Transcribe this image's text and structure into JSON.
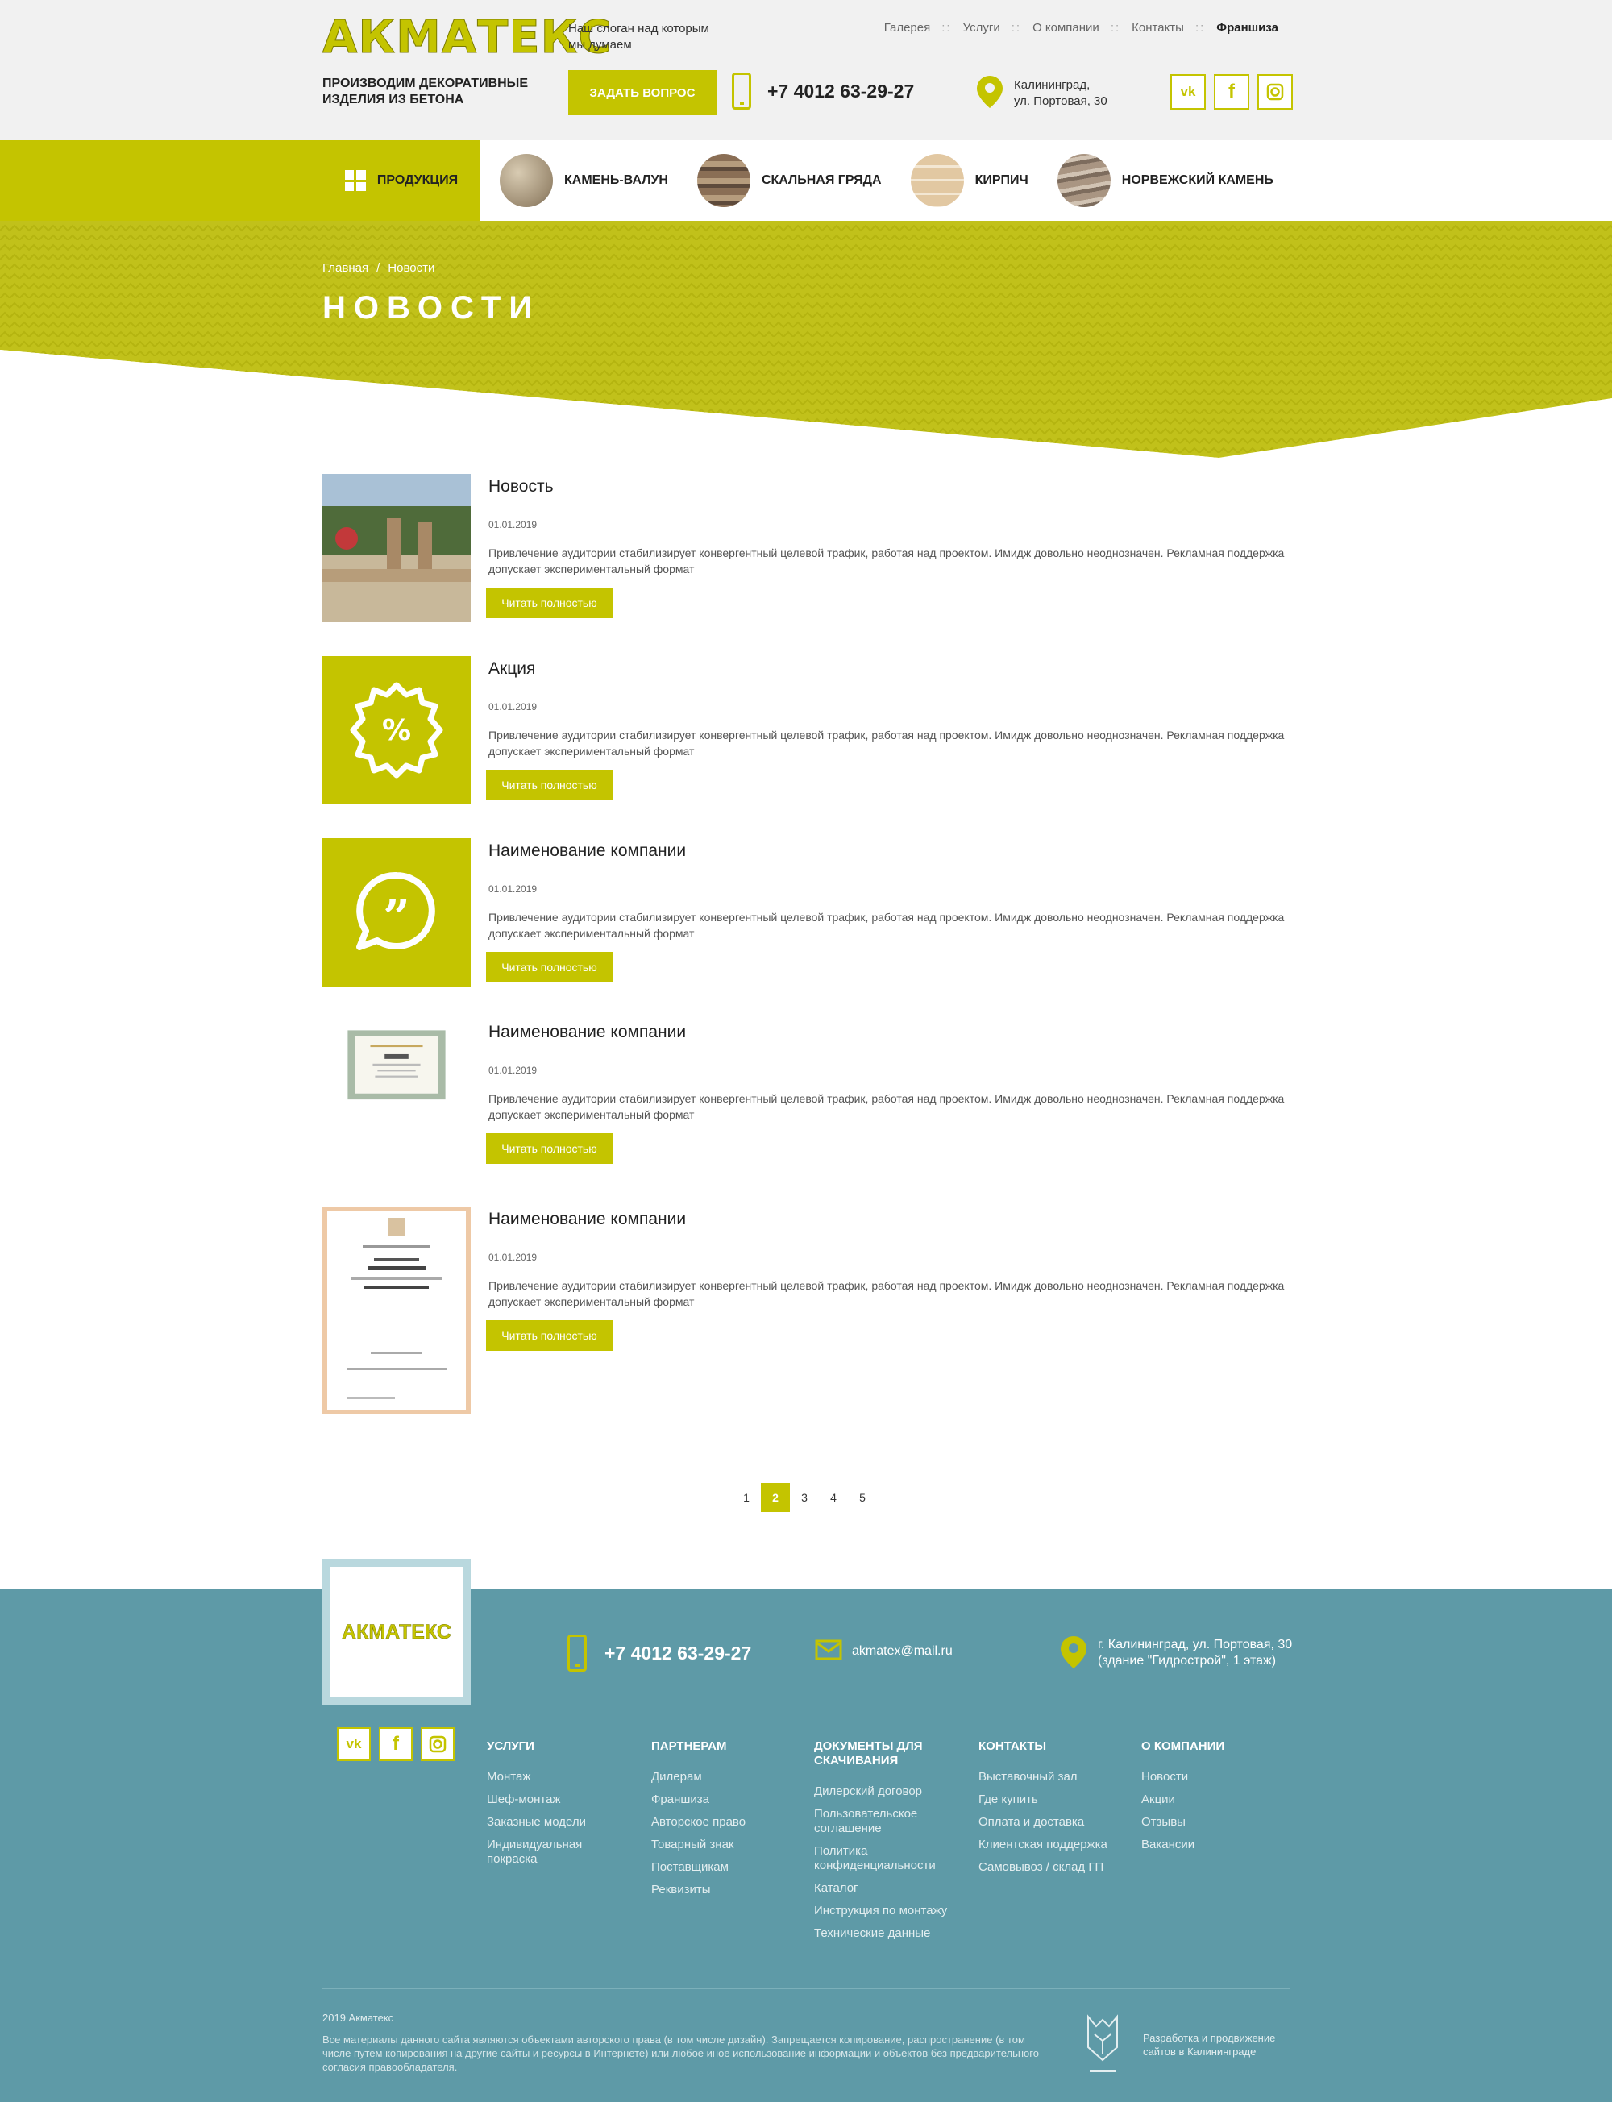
{
  "header": {
    "logo_main": "АКМАТЕКС",
    "slogan": "Наш слоган над которым мы думаем",
    "tagline": "ПРОИЗВОДИМ ДЕКОРАТИВНЫЕ ИЗДЕЛИЯ ИЗ БЕТОНА",
    "ask_button": "ЗАДАТЬ ВОПРОС",
    "phone": "+7 4012 63-29-27",
    "address_line1": "Калининград,",
    "address_line2": "ул. Портовая, 30",
    "topnav": [
      "Галерея",
      "Услуги",
      "О компании",
      "Контакты",
      "Франшиза"
    ],
    "social": [
      "vk",
      "f",
      "ig"
    ]
  },
  "prodnav": {
    "menu_label": "ПРОДУКЦИЯ",
    "categories": [
      "КАМЕНЬ-ВАЛУН",
      "СКАЛЬНАЯ ГРЯДА",
      "КИРПИЧ",
      "НОРВЕЖСКИЙ КАМЕНЬ"
    ]
  },
  "banner": {
    "breadcrumb": [
      "Главная",
      "Новости"
    ],
    "title": "НОВОСТИ"
  },
  "news": [
    {
      "title": "Новость",
      "date": "01.01.2019",
      "text": "Привлечение аудитории стабилизирует конвергентный целевой трафик, работая над проектом. Имидж довольно неоднозначен. Рекламная поддержка допускает экспериментальный формат",
      "button": "Читать полностью",
      "image": "photo"
    },
    {
      "title": "Акция",
      "date": "01.01.2019",
      "text": "Привлечение аудитории стабилизирует конвергентный целевой трафик, работая над проектом. Имидж довольно неоднозначен. Рекламная поддержка допускает экспериментальный формат",
      "button": "Читать полностью",
      "image": "percent-icon"
    },
    {
      "title": "Наименование компании",
      "date": "01.01.2019",
      "text": "Привлечение аудитории стабилизирует конвергентный целевой трафик, работая над проектом. Имидж довольно неоднозначен. Рекламная поддержка допускает экспериментальный формат",
      "button": "Читать полностью",
      "image": "quote-icon"
    },
    {
      "title": "Наименование компании",
      "date": "01.01.2019",
      "text": "Привлечение аудитории стабилизирует конвергентный целевой трафик, работая над проектом. Имидж довольно неоднозначен. Рекламная поддержка допускает экспериментальный формат",
      "button": "Читать полностью",
      "image": "certificate"
    },
    {
      "title": "Наименование компании",
      "date": "01.01.2019",
      "text": "Привлечение аудитории стабилизирует конвергентный целевой трафик, работая над проектом. Имидж довольно неоднозначен. Рекламная поддержка допускает экспериментальный формат",
      "button": "Читать полностью",
      "image": "certificate-tall"
    }
  ],
  "pagination": {
    "pages": [
      "1",
      "2",
      "3",
      "4",
      "5"
    ],
    "current": "2"
  },
  "footer": {
    "logo": "АКМАТЕКС",
    "phone": "+7 4012 63-29-27",
    "email": "akmatex@mail.ru",
    "address_line1": "г. Калининград, ул. Портовая, 30",
    "address_line2": "(здание \"Гидрострой\", 1 этаж)",
    "columns": [
      {
        "title": "УСЛУГИ",
        "links": [
          "Монтаж",
          "Шеф-монтаж",
          "Заказные модели",
          "Индивидуальная покраска"
        ]
      },
      {
        "title": "ПАРТНЕРАМ",
        "links": [
          "Дилерам",
          "Франшиза",
          "Авторское право",
          "Товарный знак",
          "Поставщикам",
          "Реквизиты"
        ]
      },
      {
        "title": "ДОКУМЕНТЫ ДЛЯ СКАЧИВАНИЯ",
        "links": [
          "Дилерский договор",
          "Пользовательское соглашение",
          "Политика конфиденциальности",
          "Каталог",
          "Инструкция по монтажу",
          "Технические данные"
        ]
      },
      {
        "title": "КОНТАКТЫ",
        "links": [
          "Выставочный зал",
          "Где купить",
          "Оплата и доставка",
          "Клиентская поддержка",
          "Самовывоз / склад ГП"
        ]
      },
      {
        "title": "О КОМПАНИИ",
        "links": [
          "Новости",
          "Акции",
          "Отзывы",
          "Вакансии"
        ]
      }
    ],
    "copyright": "2019 Акматекс",
    "legal": "Все материалы данного сайта являются объектами авторского права (в том числе дизайн). Запрещается копирование, распространение (в том числе путем копирования на другие сайты и ресурсы в Интернете) или любое иное использование информации и объектов без предварительного согласия правообладателя.",
    "developer": "Разработка и продвижение сайтов в Калининграде"
  },
  "colors": {
    "accent": "#c4c400",
    "footer_bg": "#5e9aa7",
    "header_bg": "#f1f1f1"
  }
}
